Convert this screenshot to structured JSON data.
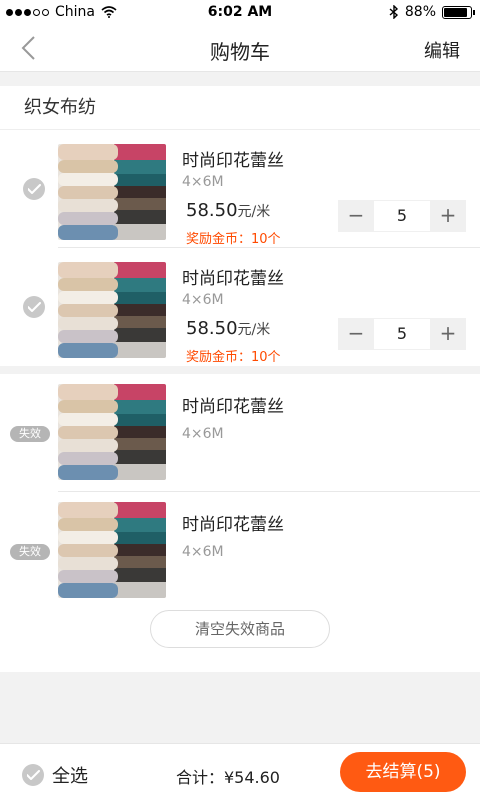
{
  "status_bar": {
    "carrier": "China",
    "time": "6:02 AM",
    "battery": "88%",
    "battery_level": 0.88
  },
  "nav": {
    "title": "购物车",
    "edit_label": "编辑"
  },
  "shop": {
    "name": "织女布纺"
  },
  "items": [
    {
      "title": "时尚印花蕾丝",
      "spec": "4×6M",
      "price": "58.50",
      "unit": "元/米",
      "reward": "奖励金币：10个",
      "quantity": "5",
      "minus": "−",
      "plus": "+"
    },
    {
      "title": "时尚印花蕾丝",
      "spec": "4×6M",
      "price": "58.50",
      "unit": "元/米",
      "reward": "奖励金币：10个",
      "quantity": "5",
      "minus": "−",
      "plus": "+"
    }
  ],
  "invalid_items": [
    {
      "badge": "失效",
      "title": "时尚印花蕾丝",
      "spec": "4×6M"
    },
    {
      "badge": "失效",
      "title": "时尚印花蕾丝",
      "spec": "4×6M"
    }
  ],
  "clear_invalid_label": "清空失效商品",
  "footer": {
    "select_all": "全选",
    "total": "合计：¥54.60",
    "checkout": "去结算(5)"
  },
  "colors": {
    "accent": "#ff5a12",
    "reward": "#ff4a00"
  }
}
